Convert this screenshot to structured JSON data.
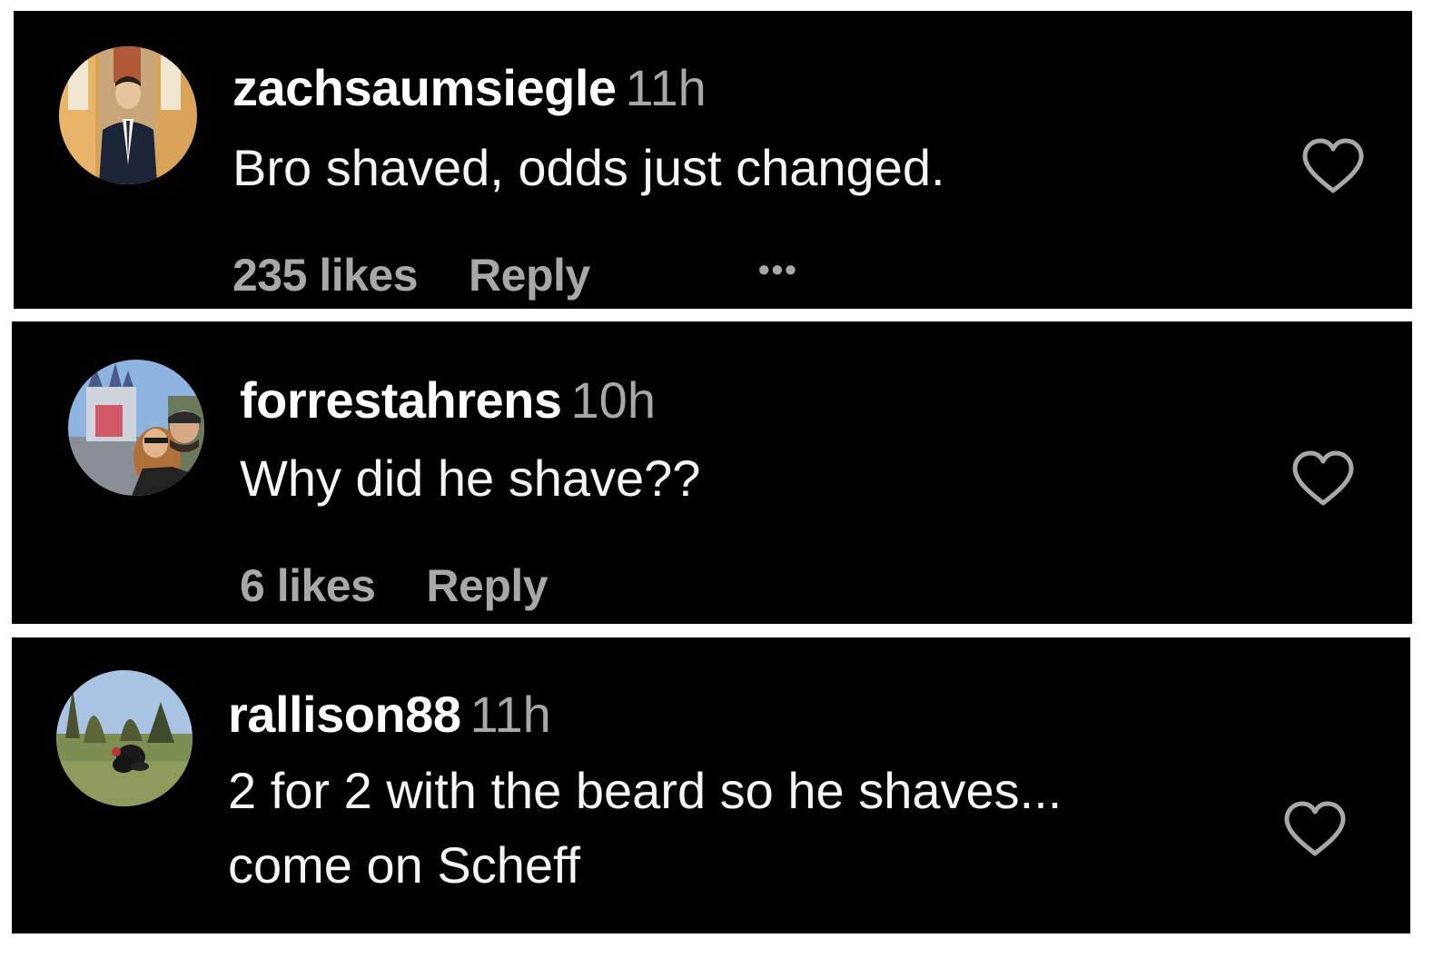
{
  "comments": [
    {
      "username": "zachsaumsiegle",
      "time": "11h",
      "text_lines": [
        "Bro shaved, odds just changed."
      ],
      "likes": "235 likes",
      "reply": "Reply",
      "more": "•••",
      "avatar_icon": "profile-photo-man-in-suit",
      "heart_icon": "heart-outline-icon"
    },
    {
      "username": "forrestahrens",
      "time": "10h",
      "text_lines": [
        "Why did he shave??"
      ],
      "likes": "6 likes",
      "reply": "Reply",
      "avatar_icon": "profile-photo-couple-at-castle",
      "heart_icon": "heart-outline-icon"
    },
    {
      "username": "rallison88",
      "time": "11h",
      "text_lines": [
        "2 for 2 with the beard so he shaves...",
        "come on Scheff"
      ],
      "avatar_icon": "profile-photo-dog-on-grass",
      "heart_icon": "heart-outline-icon"
    }
  ],
  "colors": {
    "background": "#000000",
    "separator": "#ffffff",
    "username": "#ffffff",
    "text": "#f5f5f5",
    "muted": "#a8a8a8"
  }
}
